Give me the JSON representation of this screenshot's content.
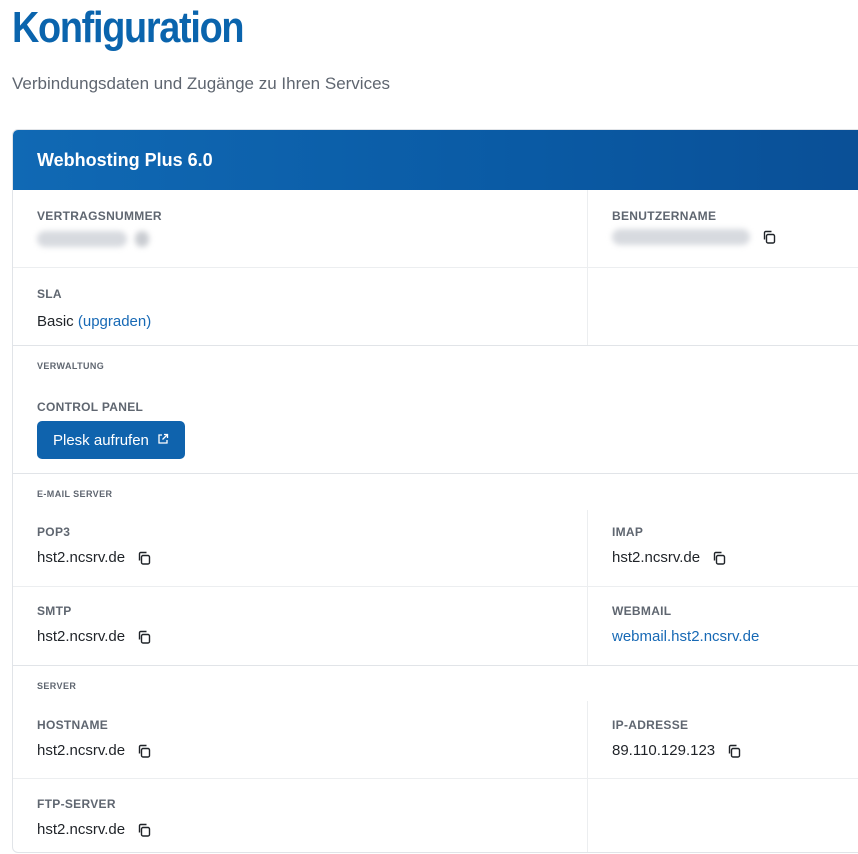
{
  "page": {
    "title": "Konfiguration",
    "subtitle": "Verbindungsdaten und Zugänge zu Ihren Services"
  },
  "card": {
    "title": "Webhosting Plus 6.0",
    "contract": {
      "label": "VERTRAGSNUMMER"
    },
    "username": {
      "label": "BENUTZERNAME"
    },
    "sla": {
      "label": "SLA",
      "value": "Basic",
      "upgrade_label": "(upgraden)"
    }
  },
  "verwaltung": {
    "section_label": "VERWALTUNG",
    "control_panel_label": "CONTROL PANEL",
    "plesk_button_label": "Plesk aufrufen"
  },
  "email": {
    "section_label": "E-MAIL SERVER",
    "pop3": {
      "label": "POP3",
      "value": "hst2.ncsrv.de"
    },
    "imap": {
      "label": "IMAP",
      "value": "hst2.ncsrv.de"
    },
    "smtp": {
      "label": "SMTP",
      "value": "hst2.ncsrv.de"
    },
    "webmail": {
      "label": "WEBMAIL",
      "value": "webmail.hst2.ncsrv.de"
    }
  },
  "server": {
    "section_label": "SERVER",
    "hostname": {
      "label": "HOSTNAME",
      "value": "hst2.ncsrv.de"
    },
    "ip": {
      "label": "IP-ADRESSE",
      "value": "89.110.129.123"
    },
    "ftp": {
      "label": "FTP-SERVER",
      "value": "hst2.ncsrv.de"
    }
  },
  "colors": {
    "brand": "#0a64ad",
    "header_gradient_start": "#1069b4",
    "header_gradient_end": "#0a4f96",
    "link": "#1769b5"
  },
  "icons": [
    "copy-icon",
    "external-link-icon"
  ]
}
